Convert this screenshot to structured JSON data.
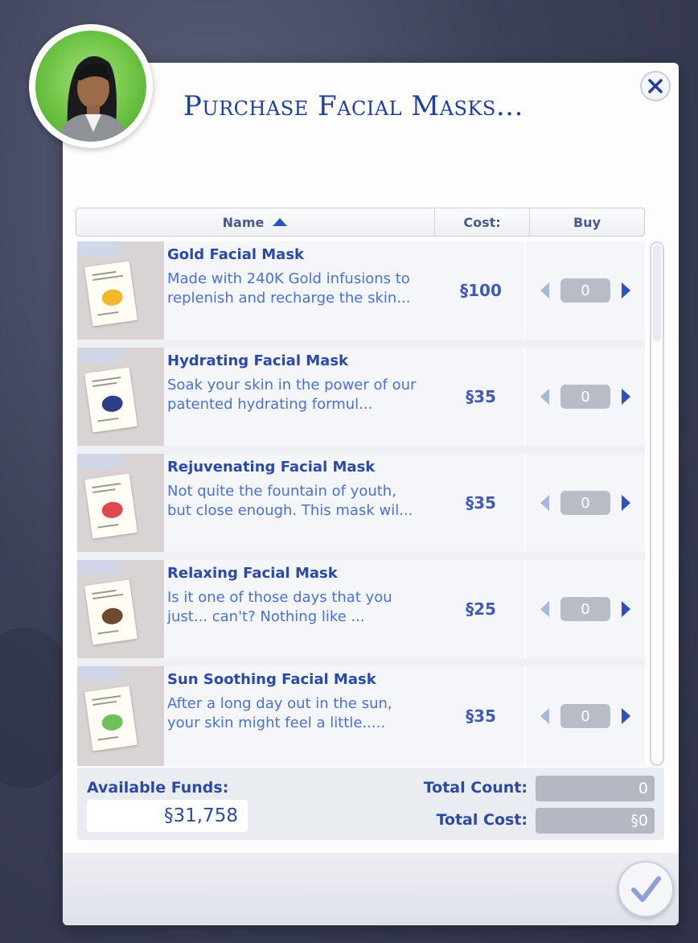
{
  "dialog": {
    "title": "Purchase Facial Masks...",
    "columns": {
      "name": "Name",
      "cost": "Cost:",
      "buy": "Buy"
    }
  },
  "items": [
    {
      "name": "Gold Facial Mask",
      "desc1": "Made with 240K Gold infusions to",
      "desc2": "replenish and recharge the skin...",
      "cost": "§100",
      "qty": "0",
      "fruit_color": "#f0b92a"
    },
    {
      "name": "Hydrating Facial Mask",
      "desc1": "Soak your skin in the power of our",
      "desc2": "patented hydrating formul...",
      "cost": "§35",
      "qty": "0",
      "fruit_color": "#2d3f8a"
    },
    {
      "name": "Rejuvenating Facial Mask",
      "desc1": "Not quite the fountain of youth,",
      "desc2": "but close enough. This mask wil...",
      "cost": "§35",
      "qty": "0",
      "fruit_color": "#e0484e"
    },
    {
      "name": "Relaxing Facial Mask",
      "desc1": "Is it one of those days that you",
      "desc2": "just... can't? Nothing like ...",
      "cost": "§25",
      "qty": "0",
      "fruit_color": "#6b4a2e"
    },
    {
      "name": "Sun Soothing Facial Mask",
      "desc1": "After a long day out in the sun,",
      "desc2": "your skin might feel a little.....",
      "cost": "§35",
      "qty": "0",
      "fruit_color": "#6fbf5a"
    }
  ],
  "footer": {
    "funds_label": "Available Funds:",
    "funds_value": "§31,758",
    "count_label": "Total Count:",
    "count_value": "0",
    "cost_label": "Total Cost:",
    "cost_value": "§0"
  },
  "colors": {
    "accent": "#2b52c2",
    "title": "#1f3f9c"
  },
  "icons": {
    "close": "close-icon",
    "confirm": "checkmark-icon",
    "sort": "sort-ascending-icon"
  }
}
